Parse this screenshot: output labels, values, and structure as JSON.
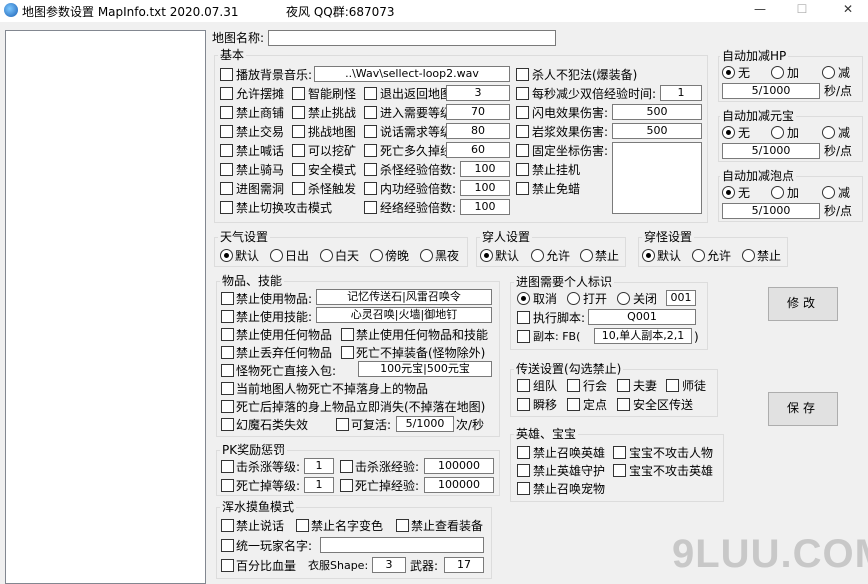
{
  "window": {
    "title": "地图参数设置 MapInfo.txt  2020.07.31",
    "author": "夜风   QQ群:687073",
    "min": "—",
    "max": "☐",
    "close": "✕"
  },
  "watermark": "9LUU.COM",
  "mapname": {
    "label": "地图名称:",
    "value": ""
  },
  "basic": {
    "title": "基本",
    "bgmusic": {
      "label": "播放背景音乐:",
      "value": "..\\Wav\\sellect-loop2.wav"
    },
    "c1": [
      "允许摆摊",
      "禁止商铺",
      "禁止交易",
      "禁止喊话",
      "禁止骑马",
      "进图需洞",
      "禁止切换攻击模式"
    ],
    "c2": [
      "智能刷怪",
      "禁止挑战",
      "挑战地图",
      "可以挖矿",
      "安全模式",
      "杀怪触发"
    ],
    "c3": [
      {
        "label": "退出返回地图:",
        "value": "3"
      },
      {
        "label": "进入需要等级:",
        "value": "70"
      },
      {
        "label": "说话需求等级:",
        "value": "80"
      },
      {
        "label": "死亡多久掉线:",
        "value": "60"
      },
      {
        "label": "杀怪经验倍数:",
        "value": "100"
      },
      {
        "label": "内功经验倍数:",
        "value": "100"
      },
      {
        "label": "经络经验倍数:",
        "value": "100"
      }
    ],
    "c4": {
      "pk": "杀人不犯法(爆装备)",
      "exp": {
        "label": "每秒减少双倍经验时间:",
        "value": "1"
      },
      "flash": {
        "label": "闪电效果伤害:",
        "value": "500"
      },
      "lava": {
        "label": "岩浆效果伤害:",
        "value": "500"
      },
      "fixed": "固定坐标伤害:",
      "guaji": "禁止挂机",
      "mianla": "禁止免蜡"
    }
  },
  "auto": [
    {
      "title": "自动加减HP",
      "opts": [
        "无",
        "加",
        "减"
      ],
      "value": "5/1000",
      "unit": "秒/点"
    },
    {
      "title": "自动加减元宝",
      "opts": [
        "无",
        "加",
        "减"
      ],
      "value": "5/1000",
      "unit": "秒/点"
    },
    {
      "title": "自动加减泡点",
      "opts": [
        "无",
        "加",
        "减"
      ],
      "value": "5/1000",
      "unit": "秒/点"
    }
  ],
  "weather": {
    "title": "天气设置",
    "opts": [
      "默认",
      "日出",
      "白天",
      "傍晚",
      "黑夜"
    ]
  },
  "wear": {
    "title": "穿人设置",
    "opts": [
      "默认",
      "允许",
      "禁止"
    ]
  },
  "wearmon": {
    "title": "穿怪设置",
    "opts": [
      "默认",
      "允许",
      "禁止"
    ]
  },
  "items": {
    "title": "物品、技能",
    "useitem": {
      "label": "禁止使用物品:",
      "value": "记忆传送石|风雷召唤令"
    },
    "useskill": {
      "label": "禁止使用技能:",
      "value": "心灵召唤|火墙|御地钉"
    },
    "anyitem": "禁止使用任何物品",
    "anyitemskill": "禁止使用任何物品和技能",
    "drop": "禁止丢弃任何物品",
    "nodrop": "死亡不掉装备(怪物除外)",
    "pack": {
      "label": "怪物死亡直接入包:",
      "value": "100元宝|500元宝"
    },
    "current": "当前地图人物死亡不掉落身上的物品",
    "vanish": "死亡后掉落的身上物品立即消失(不掉落在地图)",
    "magic": "幻魔石类失效",
    "revive": {
      "label": "可复活:",
      "value": "5/1000",
      "unit": "次/秒"
    }
  },
  "enter": {
    "title": "进图需要个人标识",
    "opts": [
      "取消",
      "打开",
      "关闭"
    ],
    "flag": "001",
    "script": {
      "label": "执行脚本:",
      "value": "Q001"
    },
    "fb": {
      "label": "副本: FB(",
      "value": "10,单人副本,2,1",
      "end": ")"
    }
  },
  "transfer": {
    "title": "传送设置(勾选禁止)",
    "opts": [
      "组队",
      "行会",
      "夫妻",
      "师徒",
      "瞬移",
      "定点",
      "安全区传送"
    ]
  },
  "hero": {
    "title": "英雄、宝宝",
    "opts": [
      "禁止召唤英雄",
      "宝宝不攻击人物",
      "禁止英雄守护",
      "宝宝不攻击英雄",
      "禁止召唤宠物"
    ]
  },
  "pk": {
    "title": "PK奖励惩罚",
    "kill_level": {
      "label": "击杀涨等级:",
      "value": "1"
    },
    "kill_exp": {
      "label": "击杀涨经验:",
      "value": "100000"
    },
    "die_level": {
      "label": "死亡掉等级:",
      "value": "1"
    },
    "die_exp": {
      "label": "死亡掉经验:",
      "value": "100000"
    }
  },
  "fish": {
    "title": "浑水摸鱼模式",
    "opts": [
      "禁止说话",
      "禁止名字变色",
      "禁止查看装备"
    ],
    "name": {
      "label": "统一玩家名字:",
      "value": ""
    },
    "hp": "百分比血量",
    "shape": {
      "label": "衣服Shape:",
      "value": "3"
    },
    "weapon": {
      "label": "武器:",
      "value": "17"
    }
  },
  "buttons": {
    "modify": "修改",
    "save": "保存"
  }
}
